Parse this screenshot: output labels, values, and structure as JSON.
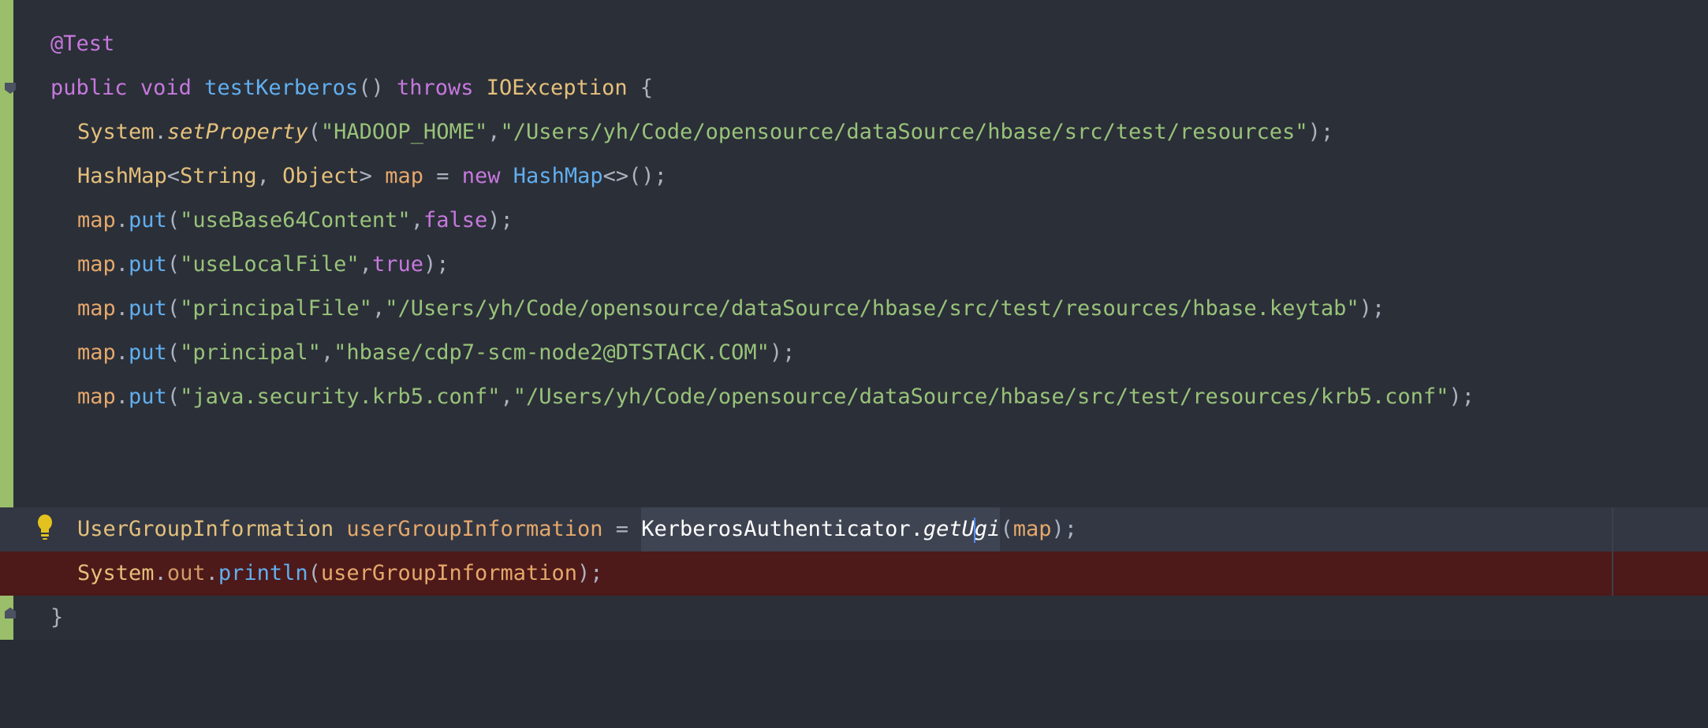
{
  "editor": {
    "lines": [
      {
        "tokens": [
          "@Test"
        ]
      },
      {
        "tokens": [
          "public",
          " ",
          "void",
          " ",
          "testKerberos",
          "() ",
          "throws",
          " ",
          "IOException",
          " {"
        ]
      },
      {
        "tokens": [
          "System",
          ".",
          "setProperty",
          "(",
          "\"HADOOP_HOME\"",
          ",",
          "\"/Users/yh/Code/opensource/dataSource/hbase/src/test/resources\"",
          ");"
        ]
      },
      {
        "tokens": [
          "HashMap",
          "<",
          "String",
          ", ",
          "Object",
          "> ",
          "map",
          " = ",
          "new",
          " ",
          "HashMap",
          "<>();"
        ]
      },
      {
        "tokens": [
          "map",
          ".",
          "put",
          "(",
          "\"useBase64Content\"",
          ",",
          "false",
          ");"
        ]
      },
      {
        "tokens": [
          "map",
          ".",
          "put",
          "(",
          "\"useLocalFile\"",
          ",",
          "true",
          ");"
        ]
      },
      {
        "tokens": [
          "map",
          ".",
          "put",
          "(",
          "\"principalFile\"",
          ",",
          "\"/Users/yh/Code/opensource/dataSource/hbase/src/test/resources/hbase.keytab\"",
          ");"
        ]
      },
      {
        "tokens": [
          "map",
          ".",
          "put",
          "(",
          "\"principal\"",
          ",",
          "\"hbase/cdp7-scm-node2@DTSTACK.COM\"",
          ");"
        ]
      },
      {
        "tokens": [
          "map",
          ".",
          "put",
          "(",
          "\"java.security.krb5.conf\"",
          ",",
          "\"/Users/yh/Code/opensource/dataSource/hbase/src/test/resources/krb5.conf\"",
          ");"
        ]
      },
      {
        "tokens": []
      },
      {
        "tokens": []
      },
      {
        "tokens": [
          "UserGroupInformation",
          " ",
          "userGroupInformation",
          " = ",
          "KerberosAuthenticator.",
          "getU",
          "gi",
          "(",
          "map",
          ");"
        ]
      },
      {
        "tokens": [
          "System",
          ".",
          "out",
          ".",
          "println",
          "(",
          "userGroupInformation",
          ");"
        ]
      },
      {
        "tokens": [
          "}"
        ]
      }
    ]
  },
  "colors": {
    "background": "#2b2f38",
    "gutter_vcs": "#9bbe6b",
    "keyword": "#c678dd",
    "class": "#e5c07b",
    "function": "#61afef",
    "string": "#98c379",
    "error_line": "#4d1919",
    "caret_line": "#323743"
  },
  "icons": {
    "bulb": "lightbulb-icon",
    "fold": "fold-marker-icon"
  }
}
